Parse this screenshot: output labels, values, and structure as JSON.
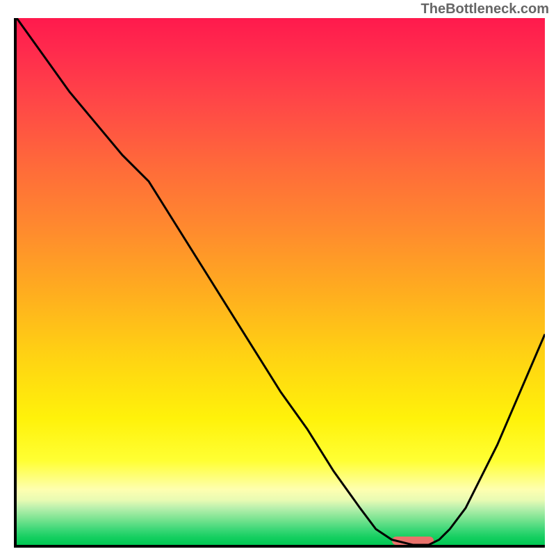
{
  "watermark": "TheBottleneck.com",
  "colors": {
    "curve": "#000000",
    "marker": "#e9726b",
    "axis": "#000000"
  },
  "chart_data": {
    "type": "line",
    "title": "",
    "xlabel": "",
    "ylabel": "",
    "xlim": [
      0,
      100
    ],
    "ylim": [
      0,
      100
    ],
    "series": [
      {
        "name": "bottleneck-curve",
        "x": [
          0,
          5,
          10,
          15,
          20,
          25,
          30,
          35,
          40,
          45,
          50,
          55,
          60,
          65,
          68,
          71,
          75,
          78,
          80,
          82,
          85,
          88,
          91,
          94,
          97,
          100
        ],
        "y": [
          100,
          93,
          86,
          80,
          74,
          69,
          61,
          53,
          45,
          37,
          29,
          22,
          14,
          7,
          3,
          1,
          0,
          0,
          1,
          3,
          7,
          13,
          19,
          26,
          33,
          40
        ]
      }
    ],
    "annotations": [
      {
        "name": "optimal-range",
        "x_start": 71,
        "x_end": 79,
        "y": 0.5,
        "color": "#e9726b"
      }
    ],
    "background_gradient": {
      "orientation": "vertical",
      "stops": [
        {
          "pos": 0.0,
          "color": "#ff1a4d"
        },
        {
          "pos": 0.5,
          "color": "#ffad1f"
        },
        {
          "pos": 0.84,
          "color": "#ffff33"
        },
        {
          "pos": 1.0,
          "color": "#00c853"
        }
      ]
    }
  }
}
